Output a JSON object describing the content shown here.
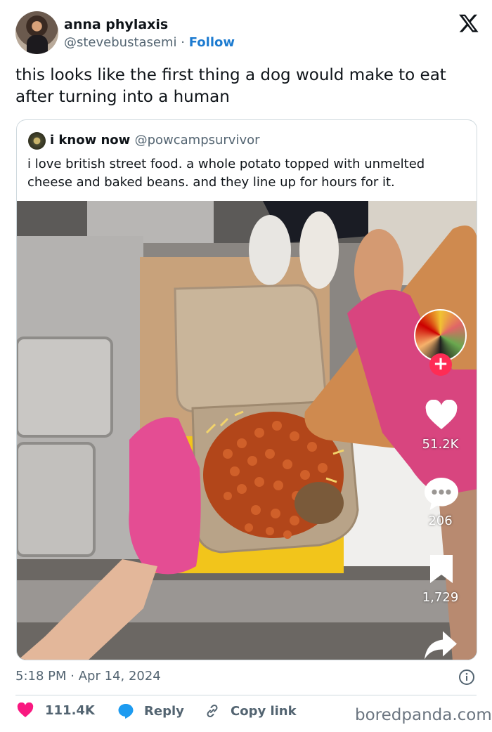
{
  "author": {
    "name": "anna phylaxis",
    "handle": "@stevebustasemi",
    "separator": "·",
    "follow_label": "Follow"
  },
  "tweet": {
    "text": "this looks like the first thing a dog would make to eat after turning into a human",
    "time": "5:18 PM",
    "date": "Apr 14, 2024",
    "time_separator": "·"
  },
  "quote": {
    "name": "i know now",
    "handle": "@powcampsurvivor",
    "text": "i love british street food. a whole potato topped with unmelted cheese and baked beans. and they line up for hours for it."
  },
  "video_overlay": {
    "likes": "51.2K",
    "comments": "206",
    "saves": "1,729",
    "plus_label": "+"
  },
  "actions": {
    "likes": "111.4K",
    "reply_label": "Reply",
    "copy_link_label": "Copy link"
  },
  "watermark": "boredpanda.com",
  "colors": {
    "follow": "#1d7bd0",
    "like": "#f91880",
    "reply": "#1d9bf0",
    "muted": "#536471"
  }
}
